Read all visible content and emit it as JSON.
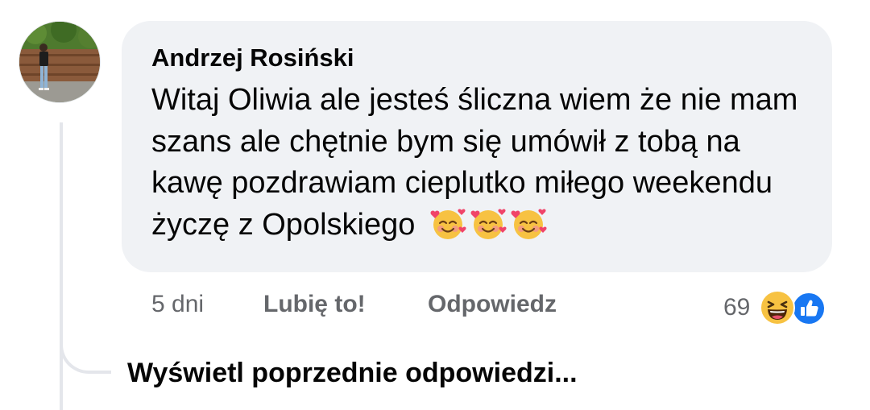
{
  "comment": {
    "author": "Andrzej Rosiński",
    "text": "Witaj Oliwia ale jesteś śliczna wiem że nie mam szans ale chętnie bym się umówił z tobą na kawę pozdrawiam cieplutko miłego weekendu życzę z Opolskiego",
    "emojis": [
      "smiling-face-with-hearts-icon",
      "smiling-face-with-hearts-icon",
      "smiling-face-with-hearts-icon"
    ],
    "time": "5 dni",
    "like_label": "Lubię to!",
    "reply_label": "Odpowiedz",
    "reaction_count": "69",
    "reaction_icons": [
      "haha-icon",
      "like-icon"
    ]
  },
  "thread": {
    "view_previous_label": "Wyświetl poprzednie odpowiedzi..."
  },
  "colors": {
    "bubble": "#f0f2f5",
    "text": "#050505",
    "secondary": "#65676b",
    "like_blue": "#1877f2",
    "thread_line": "#e4e6eb"
  }
}
